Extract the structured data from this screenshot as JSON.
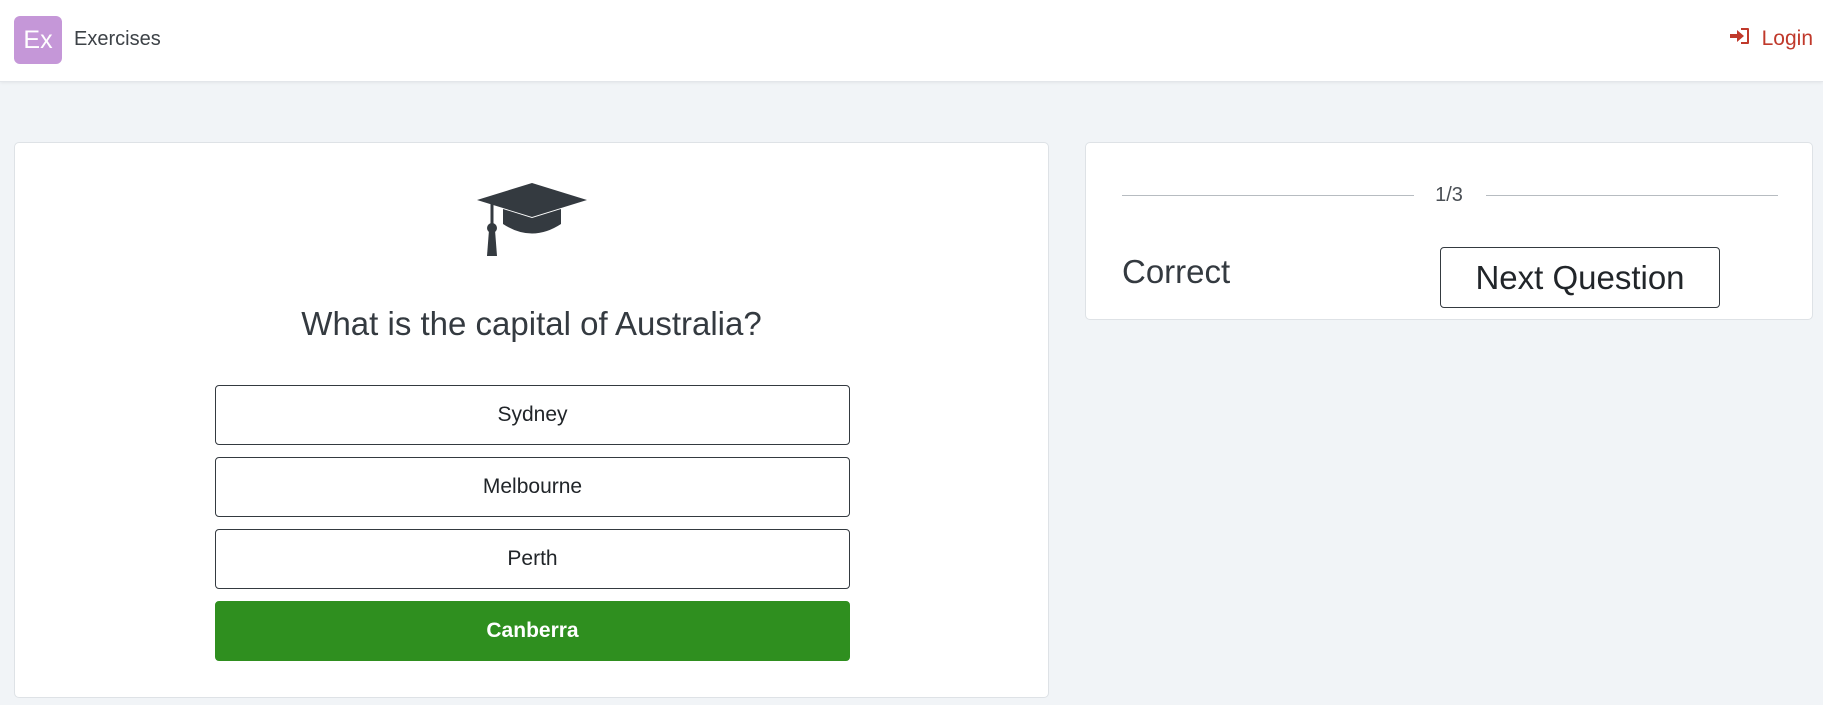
{
  "navbar": {
    "logo_text": "Ex",
    "brand_name": "Exercises",
    "login_label": "Login",
    "login_icon": "sign-in-icon"
  },
  "quiz": {
    "icon": "graduation-cap-icon",
    "question": "What is the capital of Australia?",
    "options": [
      {
        "label": "Sydney",
        "state": "default"
      },
      {
        "label": "Melbourne",
        "state": "default"
      },
      {
        "label": "Perth",
        "state": "default"
      },
      {
        "label": "Canberra",
        "state": "correct"
      }
    ]
  },
  "status": {
    "progress": "1/3",
    "result": "Correct",
    "next_label": "Next Question"
  },
  "colors": {
    "brand": "#c597d8",
    "login": "#c0392b",
    "correct": "#2f8f1f",
    "background": "#f1f4f7"
  }
}
